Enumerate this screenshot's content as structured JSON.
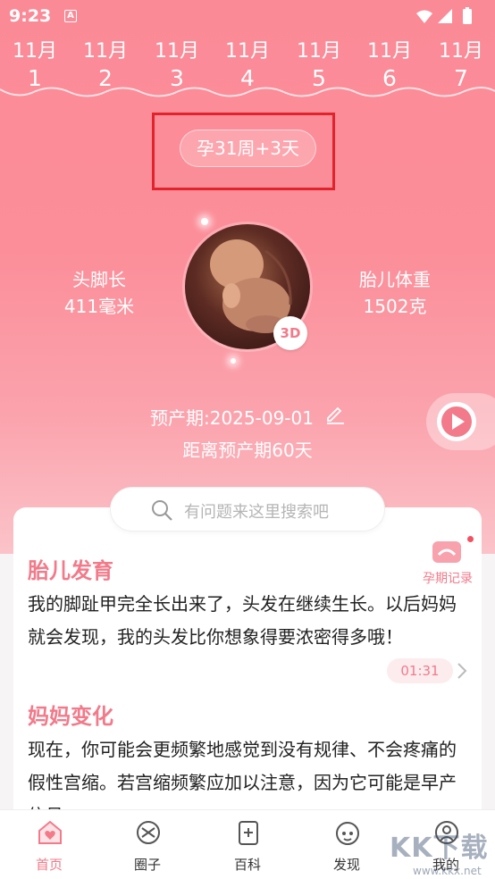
{
  "status_bar": {
    "time": "9:23",
    "notification_glyph": "A"
  },
  "week_strip": {
    "days": [
      {
        "month": "11月",
        "day": "1"
      },
      {
        "month": "11月",
        "day": "2"
      },
      {
        "month": "11月",
        "day": "3"
      },
      {
        "month": "11月",
        "day": "4"
      },
      {
        "month": "11月",
        "day": "5"
      },
      {
        "month": "11月",
        "day": "6"
      },
      {
        "month": "11月",
        "day": "7"
      }
    ]
  },
  "pregnancy": {
    "week_label": "孕31周+3天",
    "length_label": "头脚长",
    "length_value": "411毫米",
    "weight_label": "胎儿体重",
    "weight_value": "1502克",
    "badge_3d": "3D",
    "due_date": "预产期:2025-09-01",
    "countdown": "距离预产期60天"
  },
  "search": {
    "placeholder": "有问题来这里搜索吧"
  },
  "record_button": {
    "label": "孕期记录"
  },
  "fetal_development": {
    "title": "胎儿发育",
    "text": "我的脚趾甲完全长出来了，头发在继续生长。以后妈妈就会发现，我的头发比你想象得要浓密得多哦！",
    "audio_time": "01:31"
  },
  "mother_changes": {
    "title": "妈妈变化",
    "text": "现在，你可能会更频繁地感觉到没有规律、不会疼痛的假性宫缩。若宫缩频繁应加以注意，因为它可能是早产信号"
  },
  "tabbar": {
    "tabs": [
      {
        "label": "首页",
        "icon": "home-heart-icon",
        "active": true
      },
      {
        "label": "圈子",
        "icon": "circle-icon",
        "active": false
      },
      {
        "label": "百科",
        "icon": "encyclopedia-icon",
        "active": false
      },
      {
        "label": "发现",
        "icon": "discover-icon",
        "active": false
      },
      {
        "label": "我的",
        "icon": "profile-icon",
        "active": false
      }
    ]
  },
  "watermark": {
    "text": "KK下载",
    "url": "www.kkx.net"
  },
  "colors": {
    "accent": "#f27a8a",
    "hero_top": "#fb8a97",
    "highlight_box": "#e2232b"
  }
}
